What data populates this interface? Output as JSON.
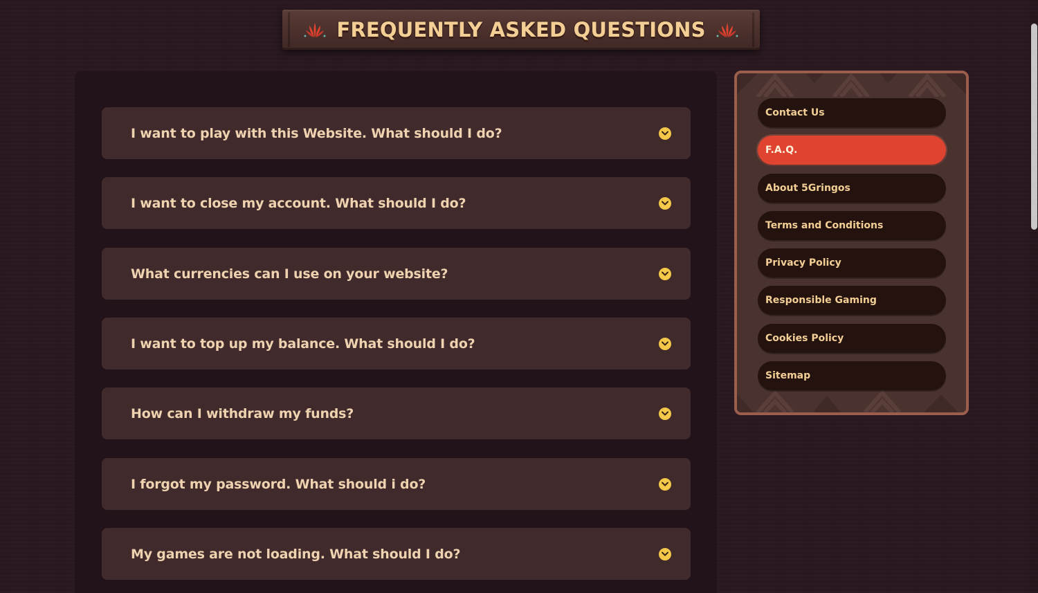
{
  "header": {
    "title": "FREQUENTLY ASKED QUESTIONS",
    "left_ornament_icon": "agave-icon",
    "right_ornament_icon": "agave-icon"
  },
  "faq": {
    "items": [
      {
        "question": "I want to play with this Website. What should I do?",
        "expand_icon": "chevron-down-icon"
      },
      {
        "question": "I want to close my account. What should I do?",
        "expand_icon": "chevron-down-icon"
      },
      {
        "question": "What currencies can I use on your website?",
        "expand_icon": "chevron-down-icon"
      },
      {
        "question": "I want to top up my balance. What should I do?",
        "expand_icon": "chevron-down-icon"
      },
      {
        "question": "How can I withdraw my funds?",
        "expand_icon": "chevron-down-icon"
      },
      {
        "question": "I forgot my password. What should i do?",
        "expand_icon": "chevron-down-icon"
      },
      {
        "question": "My games are not loading. What should I do?",
        "expand_icon": "chevron-down-icon"
      }
    ]
  },
  "sidebar": {
    "items": [
      {
        "label": "Contact Us",
        "active": false
      },
      {
        "label": "F.A.Q.",
        "active": true
      },
      {
        "label": "About 5Gringos",
        "active": false
      },
      {
        "label": "Terms and Conditions",
        "active": false
      },
      {
        "label": "Privacy Policy",
        "active": false
      },
      {
        "label": "Responsible Gaming",
        "active": false
      },
      {
        "label": "Cookies Policy",
        "active": false
      },
      {
        "label": "Sitemap",
        "active": false
      }
    ]
  },
  "colors": {
    "background": "#2a1820",
    "panel": "#22131a",
    "faq_item": "#402a2b",
    "accent_red": "#e0432f",
    "accent_yellow": "#f4c94a",
    "text_cream": "#f3cf95"
  }
}
